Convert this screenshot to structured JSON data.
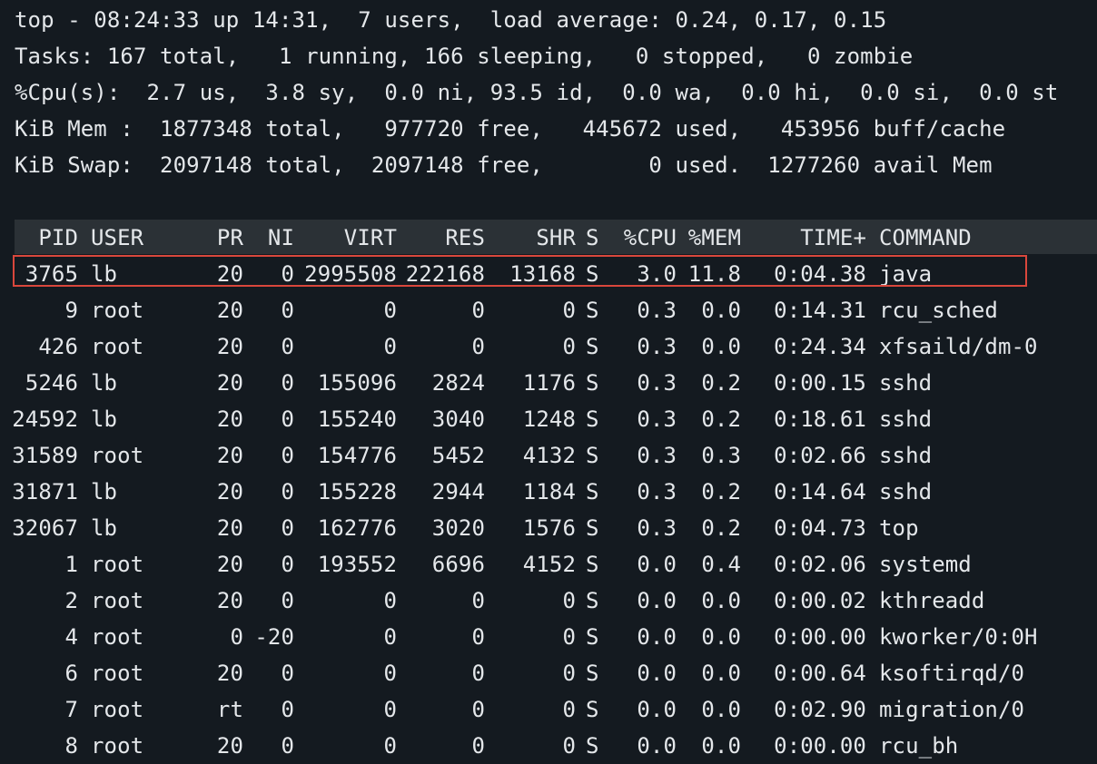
{
  "summary": {
    "line1": "top - 08:24:33 up 14:31,  7 users,  load average: 0.24, 0.17, 0.15",
    "line2": "Tasks: 167 total,   1 running, 166 sleeping,   0 stopped,   0 zombie",
    "line3": "%Cpu(s):  2.7 us,  3.8 sy,  0.0 ni, 93.5 id,  0.0 wa,  0.0 hi,  0.0 si,  0.0 st",
    "line4": "KiB Mem :  1877348 total,   977720 free,   445672 used,   453956 buff/cache",
    "line5": "KiB Swap:  2097148 total,  2097148 free,        0 used.  1277260 avail Mem"
  },
  "table": {
    "headers": {
      "pid": "PID",
      "user": "USER",
      "pr": "PR",
      "ni": "NI",
      "virt": "VIRT",
      "res": "RES",
      "shr": "SHR",
      "s": "S",
      "cpu": "%CPU",
      "mem": "%MEM",
      "time": "TIME+",
      "command": "COMMAND"
    },
    "rows": [
      {
        "pid": "3765",
        "user": "lb",
        "pr": "20",
        "ni": "0",
        "virt": "2995508",
        "res": "222168",
        "shr": "13168",
        "s": "S",
        "cpu": "3.0",
        "mem": "11.8",
        "time": "0:04.38",
        "command": "java"
      },
      {
        "pid": "9",
        "user": "root",
        "pr": "20",
        "ni": "0",
        "virt": "0",
        "res": "0",
        "shr": "0",
        "s": "S",
        "cpu": "0.3",
        "mem": "0.0",
        "time": "0:14.31",
        "command": "rcu_sched"
      },
      {
        "pid": "426",
        "user": "root",
        "pr": "20",
        "ni": "0",
        "virt": "0",
        "res": "0",
        "shr": "0",
        "s": "S",
        "cpu": "0.3",
        "mem": "0.0",
        "time": "0:24.34",
        "command": "xfsaild/dm-0"
      },
      {
        "pid": "5246",
        "user": "lb",
        "pr": "20",
        "ni": "0",
        "virt": "155096",
        "res": "2824",
        "shr": "1176",
        "s": "S",
        "cpu": "0.3",
        "mem": "0.2",
        "time": "0:00.15",
        "command": "sshd"
      },
      {
        "pid": "24592",
        "user": "lb",
        "pr": "20",
        "ni": "0",
        "virt": "155240",
        "res": "3040",
        "shr": "1248",
        "s": "S",
        "cpu": "0.3",
        "mem": "0.2",
        "time": "0:18.61",
        "command": "sshd"
      },
      {
        "pid": "31589",
        "user": "root",
        "pr": "20",
        "ni": "0",
        "virt": "154776",
        "res": "5452",
        "shr": "4132",
        "s": "S",
        "cpu": "0.3",
        "mem": "0.3",
        "time": "0:02.66",
        "command": "sshd"
      },
      {
        "pid": "31871",
        "user": "lb",
        "pr": "20",
        "ni": "0",
        "virt": "155228",
        "res": "2944",
        "shr": "1184",
        "s": "S",
        "cpu": "0.3",
        "mem": "0.2",
        "time": "0:14.64",
        "command": "sshd"
      },
      {
        "pid": "32067",
        "user": "lb",
        "pr": "20",
        "ni": "0",
        "virt": "162776",
        "res": "3020",
        "shr": "1576",
        "s": "S",
        "cpu": "0.3",
        "mem": "0.2",
        "time": "0:04.73",
        "command": "top"
      },
      {
        "pid": "1",
        "user": "root",
        "pr": "20",
        "ni": "0",
        "virt": "193552",
        "res": "6696",
        "shr": "4152",
        "s": "S",
        "cpu": "0.0",
        "mem": "0.4",
        "time": "0:02.06",
        "command": "systemd"
      },
      {
        "pid": "2",
        "user": "root",
        "pr": "20",
        "ni": "0",
        "virt": "0",
        "res": "0",
        "shr": "0",
        "s": "S",
        "cpu": "0.0",
        "mem": "0.0",
        "time": "0:00.02",
        "command": "kthreadd"
      },
      {
        "pid": "4",
        "user": "root",
        "pr": "0",
        "ni": "-20",
        "virt": "0",
        "res": "0",
        "shr": "0",
        "s": "S",
        "cpu": "0.0",
        "mem": "0.0",
        "time": "0:00.00",
        "command": "kworker/0:0H"
      },
      {
        "pid": "6",
        "user": "root",
        "pr": "20",
        "ni": "0",
        "virt": "0",
        "res": "0",
        "shr": "0",
        "s": "S",
        "cpu": "0.0",
        "mem": "0.0",
        "time": "0:00.64",
        "command": "ksoftirqd/0"
      },
      {
        "pid": "7",
        "user": "root",
        "pr": "rt",
        "ni": "0",
        "virt": "0",
        "res": "0",
        "shr": "0",
        "s": "S",
        "cpu": "0.0",
        "mem": "0.0",
        "time": "0:02.90",
        "command": "migration/0"
      },
      {
        "pid": "8",
        "user": "root",
        "pr": "20",
        "ni": "0",
        "virt": "0",
        "res": "0",
        "shr": "0",
        "s": "S",
        "cpu": "0.0",
        "mem": "0.0",
        "time": "0:00.00",
        "command": "rcu_bh"
      }
    ]
  },
  "colors": {
    "background": "#141a20",
    "text": "#e4e7ea",
    "header_bar": "#2b3136",
    "highlight_border": "#d9473c"
  }
}
